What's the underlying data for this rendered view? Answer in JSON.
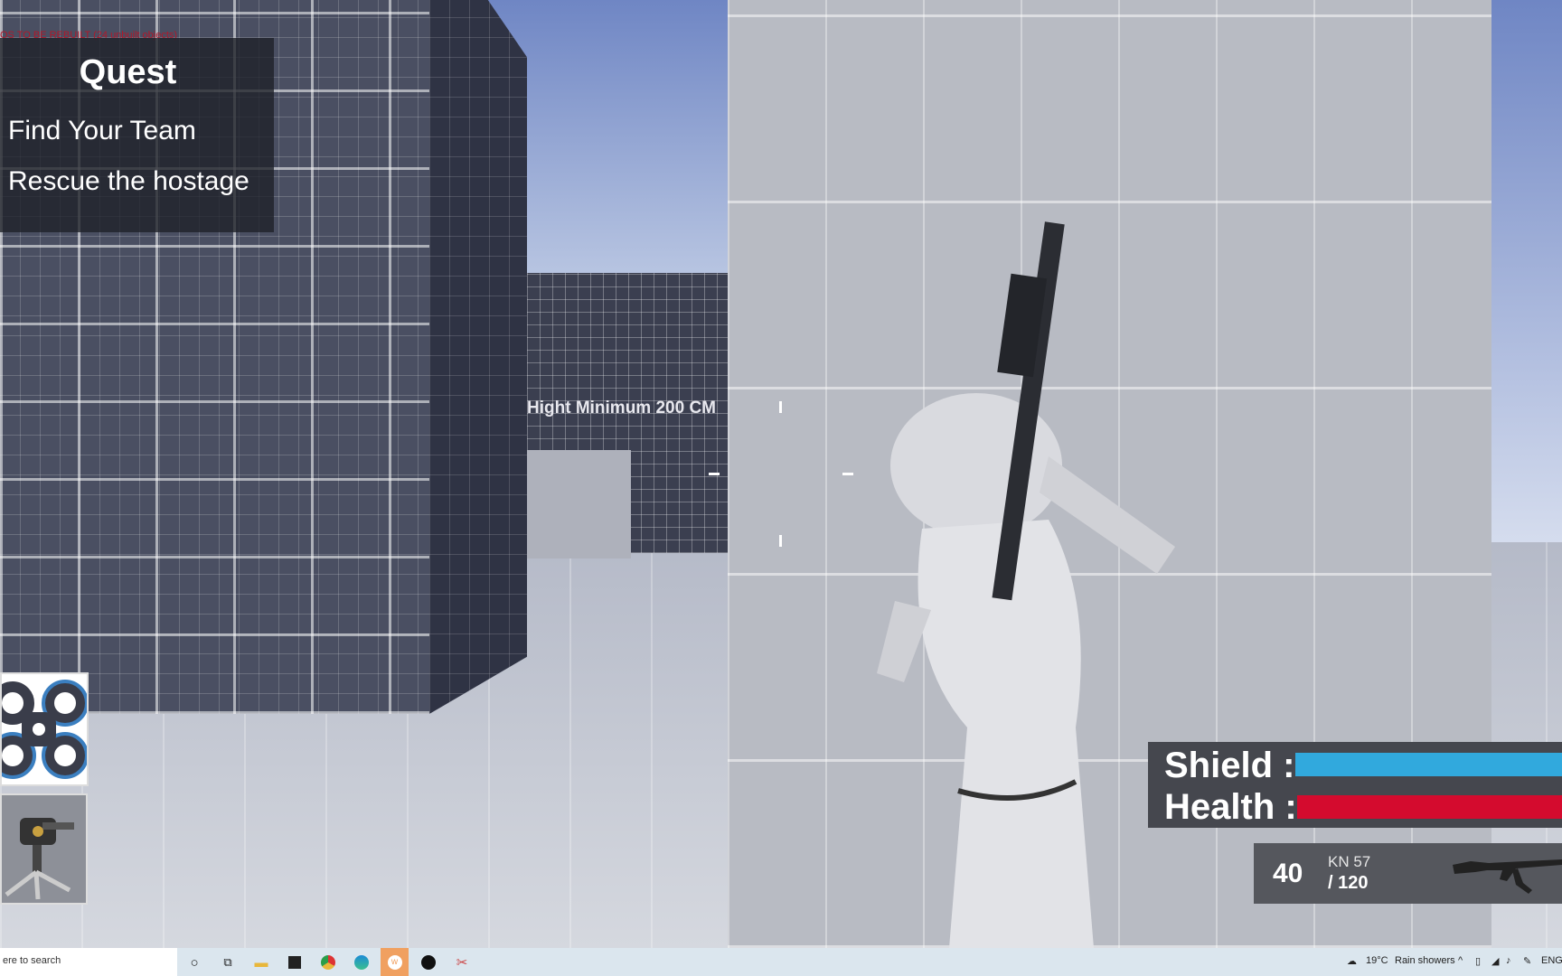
{
  "debug_text": "OS TO BE REBUILT (24 unbuilt objects)",
  "world_sign": "Hight Minimum 200 CM",
  "quest": {
    "title": "Quest",
    "items": [
      "Find Your Team",
      "Rescue the hostage"
    ]
  },
  "abilities": [
    {
      "icon": "drone-icon"
    },
    {
      "icon": "turret-icon"
    }
  ],
  "stats": {
    "shield_label": "Shield :",
    "health_label": "Health :",
    "shield_color": "#31a9dd",
    "health_color": "#d40b2e",
    "shield_fraction": 1.0,
    "health_fraction": 1.0
  },
  "weapon": {
    "ammo": "40",
    "name": "KN 57",
    "reserve": "/ 120",
    "icon": "rifle-icon"
  },
  "taskbar": {
    "search_placeholder": "ere to search",
    "apps": [
      "cortana-icon",
      "task-view-icon",
      "file-explorer-icon",
      "store-icon",
      "chrome-icon",
      "edge-icon",
      "app-w-icon",
      "unreal-engine-icon",
      "snipping-tool-icon"
    ],
    "weather_temp": "19°C",
    "weather_text": "Rain showers",
    "language": "ENG"
  }
}
